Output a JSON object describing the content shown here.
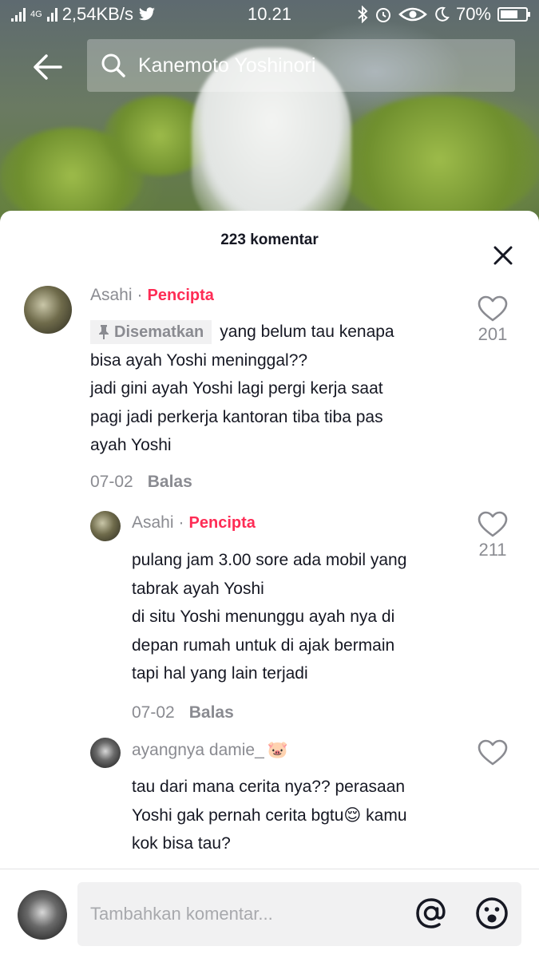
{
  "status_bar": {
    "network": "4G",
    "speed": "2,54KB/s",
    "time": "10.21",
    "battery": "70%",
    "battery_level": 0.7,
    "icons": [
      "signal-icon",
      "twitter-icon",
      "bluetooth-icon",
      "alarm-icon",
      "eye-icon",
      "moon-icon",
      "battery-icon"
    ]
  },
  "search": {
    "query": "Kanemoto Yoshinori"
  },
  "sheet": {
    "title": "223 komentar"
  },
  "comments": [
    {
      "username": "Asahi",
      "badge": "Pencipta",
      "pinned_label": "Disematkan",
      "lines": [
        "yang belum tau kenapa",
        "bisa ayah Yoshi meninggal??",
        "jadi gini ayah Yoshi lagi pergi kerja saat",
        "pagi jadi perkerja kantoran tiba tiba pas",
        "ayah Yoshi"
      ],
      "date": "07-02",
      "reply": "Balas",
      "likes": "201"
    },
    {
      "username": "Asahi",
      "badge": "Pencipta",
      "lines": [
        "pulang jam 3.00 sore ada mobil yang",
        "tabrak ayah Yoshi",
        "di situ Yoshi menunggu ayah nya di",
        "depan rumah untuk di ajak bermain",
        "tapi hal yang lain terjadi"
      ],
      "date": "07-02",
      "reply": "Balas",
      "likes": "211"
    },
    {
      "username": "ayangnya damie_",
      "username_emoji": "🐷",
      "lines": [
        "tau dari mana cerita nya?? perasaan",
        "Yoshi gak pernah cerita bgtu",
        "kok bisa tau?"
      ],
      "inline_emoji": "😌",
      "line2_suffix": " kamu"
    }
  ],
  "input": {
    "placeholder": "Tambahkan komentar..."
  },
  "colors": {
    "creator_badge": "#fe2c55",
    "text": "#161823",
    "muted": "#8a8b91"
  }
}
